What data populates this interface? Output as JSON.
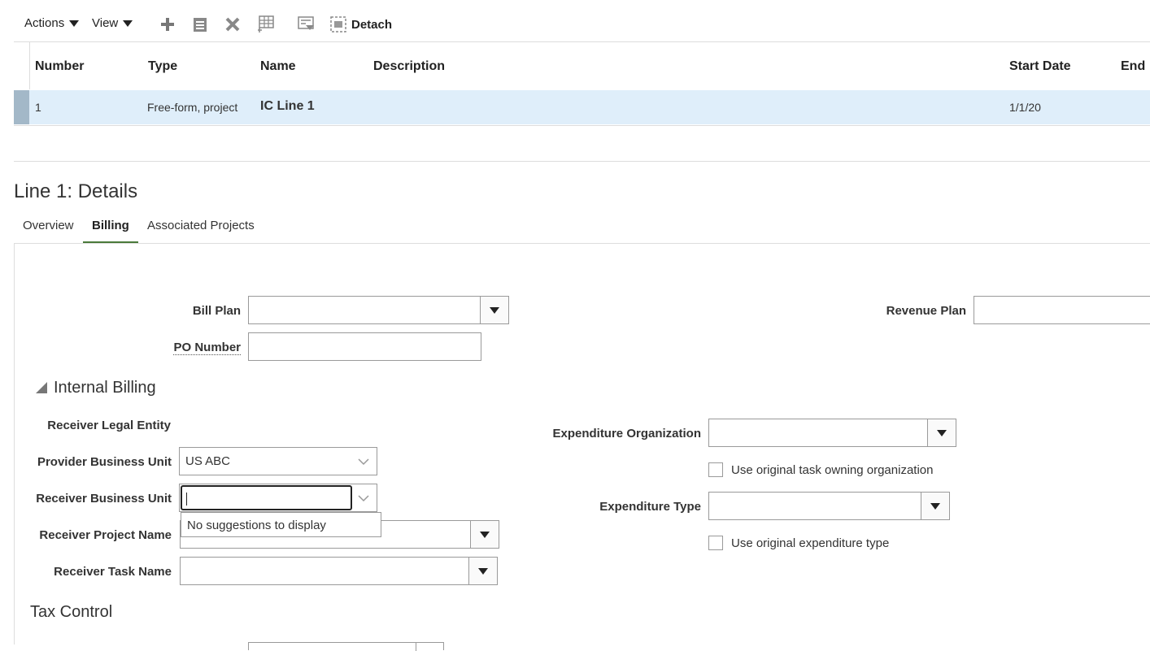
{
  "toolbar": {
    "actions_label": "Actions",
    "view_label": "View",
    "detach_label": "Detach",
    "icons": [
      "plus-icon",
      "edit-icon",
      "delete-icon",
      "freeze-icon",
      "query-by-example-icon",
      "detach-icon"
    ]
  },
  "table": {
    "columns": [
      "Number",
      "Type",
      "Name",
      "Description",
      "Start Date",
      "End"
    ],
    "rows": [
      {
        "number": "1",
        "type": "Free-form, project",
        "name": "IC Line 1",
        "description": "",
        "start_date": "1/1/20",
        "end": ""
      }
    ]
  },
  "details": {
    "title": "Line 1: Details",
    "tabs": [
      {
        "label": "Overview",
        "selected": false
      },
      {
        "label": "Billing",
        "selected": true
      },
      {
        "label": "Associated Projects",
        "selected": false
      }
    ]
  },
  "billing": {
    "bill_plan_label": "Bill Plan",
    "bill_plan_value": "",
    "revenue_plan_label": "Revenue Plan",
    "revenue_plan_value": "",
    "po_number_label": "PO Number",
    "po_number_value": ""
  },
  "internal_billing": {
    "section_title": "Internal Billing",
    "receiver_legal_entity_label": "Receiver Legal Entity",
    "provider_bu_label": "Provider Business Unit",
    "provider_bu_value": "US ABC",
    "receiver_bu_label": "Receiver Business Unit",
    "receiver_bu_value": "",
    "suggestions_text": "No suggestions to display",
    "receiver_project_label": "Receiver Project Name",
    "receiver_task_label": "Receiver Task Name",
    "expenditure_org_label": "Expenditure Organization",
    "use_task_org_label": "Use original task owning organization",
    "expenditure_type_label": "Expenditure Type",
    "use_exp_type_label": "Use original expenditure type"
  },
  "tax_control": {
    "section_title": "Tax Control"
  },
  "colors": {
    "selected_row": "#dfeefa",
    "row_marker": "#a3b8c8",
    "tab_underline": "#4a7a3a"
  }
}
